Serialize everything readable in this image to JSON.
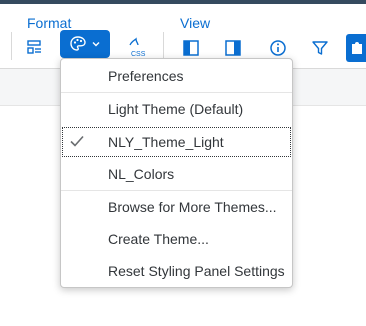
{
  "toolbar": {
    "format_label": "Format",
    "view_label": "View"
  },
  "icons": {
    "format_grid": "layout-grid-icon",
    "theme": "palette-icon",
    "css": "css-icon",
    "left_panel": "left-panel-icon",
    "right_panel": "right-panel-icon",
    "info": "info-icon",
    "filter": "filter-icon",
    "chevron": "chevron-down-icon",
    "check": "checkmark-icon"
  },
  "menu": {
    "items": [
      {
        "label": "Preferences"
      },
      {
        "label": "Light Theme (Default)"
      },
      {
        "label": "NLY_Theme_Light",
        "selected": true
      },
      {
        "label": "NL_Colors"
      },
      {
        "label": "Browse for More Themes..."
      },
      {
        "label": "Create Theme..."
      },
      {
        "label": "Reset Styling Panel Settings"
      }
    ]
  },
  "colors": {
    "accent": "#0a6ed1",
    "shell": "#354a5f",
    "text": "#32363a"
  }
}
